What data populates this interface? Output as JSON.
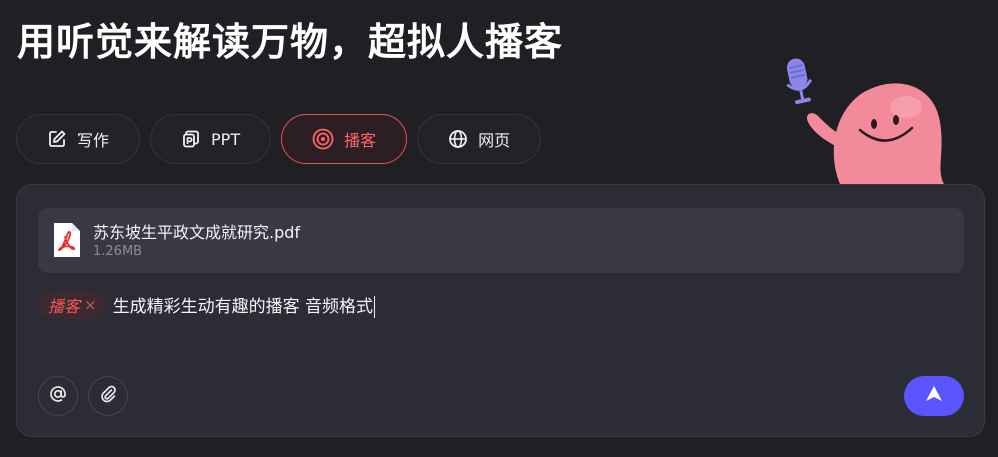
{
  "header": {
    "title": "用听觉来解读万物，超拟人播客"
  },
  "tabs": [
    {
      "label": "写作",
      "icon": "pen-edit-icon",
      "active": false
    },
    {
      "label": "PPT",
      "icon": "ppt-icon",
      "active": false
    },
    {
      "label": "播客",
      "icon": "podcast-icon",
      "active": true
    },
    {
      "label": "网页",
      "icon": "globe-icon",
      "active": false
    }
  ],
  "attachment": {
    "file_name": "苏东坡生平政文成就研究.pdf",
    "file_size": "1.26MB",
    "icon": "pdf-file-icon"
  },
  "composer": {
    "tag_label": "播客",
    "tag_close": "×",
    "prompt_text": "生成精彩生动有趣的播客 音频格式"
  },
  "toolbar": {
    "mention_icon": "at-mention-icon",
    "attach_icon": "paperclip-icon",
    "send_icon": "send-arrow-icon"
  },
  "colors": {
    "background": "#1f1f24",
    "panel": "#2b2c35",
    "accent_red": "#f25757",
    "send_button": "#5b55ff"
  }
}
